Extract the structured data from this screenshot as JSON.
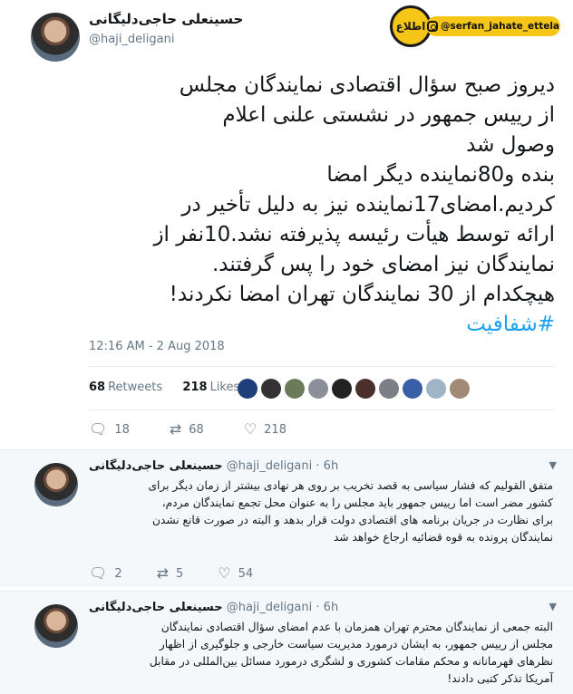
{
  "brand": {
    "logo_text": "اطلاع",
    "handle": "@serfan_jahate_ettela"
  },
  "tweet": {
    "author_name": "حسینعلی حاجی‌دلیگانی",
    "author_handle": "@haji_deligani",
    "text": "دیروز صبح سؤال اقتصادی نمایندگان مجلس\nاز رییس جمهور در نشستی علنی اعلام\nوصول شد\nبنده و80نماینده دیگر امضا\nکردیم.امضای17نماینده نیز به دلیل تأخیر در\nارائه توسط هیأت رئیسه پذیرفته نشد.10نفر از\nنمایندگان نیز امضای خود را پس گرفتند.\nهیچکدام از 30 نمایندگان تهران امضا نکردند!",
    "hashtag": "#شفافیت",
    "timestamp": "12:16 AM - 2 Aug 2018",
    "retweets_count": "68",
    "retweets_label": "Retweets",
    "likes_count": "218",
    "likes_label": "Likes",
    "replies": "18",
    "retweets": "68",
    "likes": "218",
    "liker_colors": [
      "#1f3f7a",
      "#333333",
      "#6a7b5a",
      "#8a8f99",
      "#222222",
      "#4a2f2a",
      "#7c7f86",
      "#3b5ea8",
      "#9fb4c6",
      "#a08a77"
    ]
  },
  "replies": [
    {
      "author_name": "حسینعلی حاجی‌دلیگانی",
      "author_handle": "@haji_deligani",
      "time": "6h",
      "text": "متفق القولیم که فشار سیاسی به قصد تخریب بر روی هر نهادی بیشتر از زمان دیگر برای\nکشور مضر است اما رییس جمهور باید مجلس را به عنوان محل تجمع نمایندگان مردم،\nبرای نظارت در جریان برنامه های اقتصادی دولت قرار بدهد و البته در صورت قانع نشدن\nنمایندگان پرونده به قوه قضائیه ارجاع خواهد شد",
      "replies": "2",
      "retweets": "5",
      "likes": "54"
    },
    {
      "author_name": "حسینعلی حاجی‌دلیگانی",
      "author_handle": "@haji_deligani",
      "time": "6h",
      "text": "البته جمعی از نمایندگان محترم تهران همزمان با عدم امضای سؤال اقتصادی نمایندگان\nمجلس از رییس جمهور، به ایشان درمورد مدیریت سیاست خارجی و جلوگیری از اظهار\nنظرهای قهرمانانه و محکم مقامات کشوری و لشگری درمورد مسائل بین‌المللی در مقابل\nآمریکا تذکر کتبی دادند!"
    }
  ],
  "icons": {
    "reply": "reply-icon",
    "retweet": "retweet-icon",
    "like": "heart-icon",
    "more": "chevron-down-icon"
  }
}
